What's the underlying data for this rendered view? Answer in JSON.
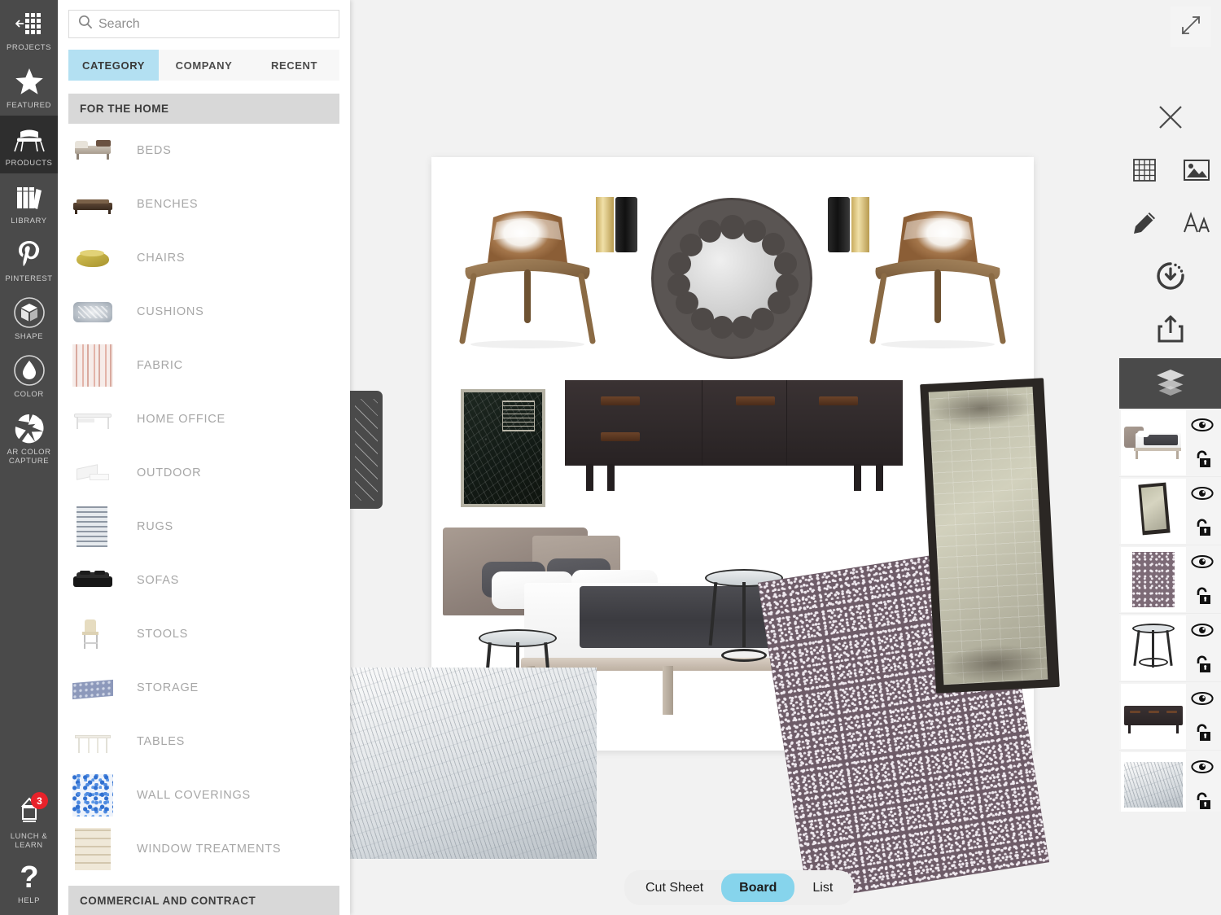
{
  "app": {
    "accent_blue": "#86d4ec",
    "tab_highlight": "#b3e0f2",
    "rail_bg": "#4a4a4a",
    "rail_active_bg": "#2e2e2e",
    "badge_red": "#e8222a"
  },
  "rail": {
    "items": [
      {
        "label": "PROJECTS",
        "icon": "grid-arrow-icon",
        "active": false,
        "badge": null
      },
      {
        "label": "FEATURED",
        "icon": "star-icon",
        "active": false,
        "badge": null
      },
      {
        "label": "PRODUCTS",
        "icon": "armchair-icon",
        "active": true,
        "badge": null
      },
      {
        "label": "LIBRARY",
        "icon": "books-icon",
        "active": false,
        "badge": null
      },
      {
        "label": "PINTEREST",
        "icon": "pinterest-icon",
        "active": false,
        "badge": null
      },
      {
        "label": "SHAPE",
        "icon": "cube-circle-icon",
        "active": false,
        "badge": null
      },
      {
        "label": "COLOR",
        "icon": "droplet-circle-icon",
        "active": false,
        "badge": null
      },
      {
        "label": "AR COLOR CAPTURE",
        "icon": "aperture-icon",
        "active": false,
        "badge": null
      }
    ],
    "bottom_items": [
      {
        "label": "LUNCH & LEARN",
        "icon": "lantern-icon",
        "badge": "3"
      },
      {
        "label": "HELP",
        "icon": "question-mark-icon",
        "badge": null
      }
    ]
  },
  "panel": {
    "search": {
      "placeholder": "Search",
      "value": "",
      "icon": "search-icon"
    },
    "tabs": [
      {
        "label": "CATEGORY",
        "active": true
      },
      {
        "label": "COMPANY",
        "active": false
      },
      {
        "label": "RECENT",
        "active": false
      }
    ],
    "group_heading": "FOR THE HOME",
    "categories": [
      {
        "label": "BEDS",
        "thumb": "bed-thumb"
      },
      {
        "label": "BENCHES",
        "thumb": "bench-thumb"
      },
      {
        "label": "CHAIRS",
        "thumb": "chair-thumb"
      },
      {
        "label": "CUSHIONS",
        "thumb": "cushion-thumb"
      },
      {
        "label": "FABRIC",
        "thumb": "fabric-thumb"
      },
      {
        "label": "HOME OFFICE",
        "thumb": "desk-thumb"
      },
      {
        "label": "OUTDOOR",
        "thumb": "lounger-thumb"
      },
      {
        "label": "RUGS",
        "thumb": "rug-thumb"
      },
      {
        "label": "SOFAS",
        "thumb": "sofa-thumb"
      },
      {
        "label": "STOOLS",
        "thumb": "stool-thumb"
      },
      {
        "label": "STORAGE",
        "thumb": "storage-thumb"
      },
      {
        "label": "TABLES",
        "thumb": "table-thumb"
      },
      {
        "label": "WALL COVERINGS",
        "thumb": "wallcovering-thumb"
      },
      {
        "label": "WINDOW TREATMENTS",
        "thumb": "blinds-thumb"
      }
    ],
    "group_heading_2": "COMMERCIAL AND CONTRACT"
  },
  "canvas": {
    "expand_icon": "expand-arrows-icon",
    "board_items": [
      "shell-chair-left",
      "wall-sconce-left",
      "round-scalloped-mirror",
      "wall-sconce-right",
      "shell-chair-right",
      "framed-map-art",
      "dark-credenza",
      "platform-bed",
      "side-table-front",
      "side-table-back",
      "leaning-floor-mirror",
      "purple-pebble-rug",
      "white-woven-rug"
    ]
  },
  "tools": {
    "buttons": [
      {
        "name": "close-button",
        "icon": "close-x-icon",
        "active": false
      },
      {
        "name": "grid-button",
        "icon": "grid-icon",
        "active": false
      },
      {
        "name": "image-button",
        "icon": "picture-icon",
        "active": false
      },
      {
        "name": "draw-button",
        "icon": "pencil-icon",
        "active": false
      },
      {
        "name": "text-button",
        "icon": "text-aa-icon",
        "active": false
      },
      {
        "name": "history-button",
        "icon": "clock-download-icon",
        "active": false
      },
      {
        "name": "share-button",
        "icon": "share-upload-icon",
        "active": false
      },
      {
        "name": "layers-button",
        "icon": "layers-stack-icon",
        "active": true
      }
    ]
  },
  "layers": {
    "visibility_icon": "eye-icon",
    "lock_icon": "unlocked-padlock-icon",
    "items": [
      {
        "name": "side-table-layer",
        "thumb": "stool-layer-thumb",
        "visible": true,
        "locked": false
      },
      {
        "name": "platform-bed-layer",
        "thumb": "bed-layer-thumb",
        "visible": true,
        "locked": false
      },
      {
        "name": "floor-mirror-layer",
        "thumb": "mirror-layer-thumb",
        "visible": true,
        "locked": false
      },
      {
        "name": "purple-rug-layer",
        "thumb": "purplerug-layer-thumb",
        "visible": true,
        "locked": false
      },
      {
        "name": "stool-layer",
        "thumb": "stool2-layer-thumb",
        "visible": true,
        "locked": false
      },
      {
        "name": "credenza-layer",
        "thumb": "credenza-layer-thumb",
        "visible": true,
        "locked": false
      },
      {
        "name": "white-rug-layer",
        "thumb": "whiterug-layer-thumb",
        "visible": true,
        "locked": false
      }
    ]
  },
  "view_toggle": {
    "options": [
      {
        "label": "Cut Sheet",
        "active": false
      },
      {
        "label": "Board",
        "active": true
      },
      {
        "label": "List",
        "active": false
      }
    ]
  }
}
